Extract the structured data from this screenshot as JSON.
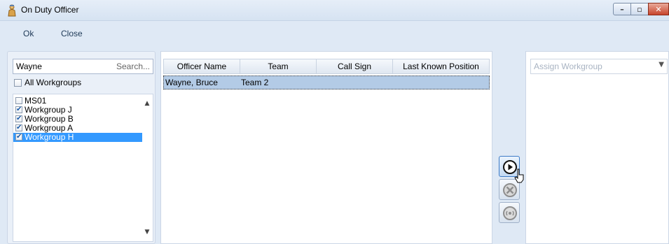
{
  "window": {
    "title": "On Duty Officer",
    "controls": [
      "minimize",
      "maximize",
      "close"
    ]
  },
  "menu": {
    "ok_label": "Ok",
    "close_label": "Close"
  },
  "search": {
    "value": "Wayne",
    "placeholder": "Search..."
  },
  "filters": {
    "all_workgroups_label": "All Workgroups",
    "all_workgroups_checked": false
  },
  "workgroups": [
    {
      "label": "MS01",
      "checked": false,
      "selected": false
    },
    {
      "label": "Workgroup J",
      "checked": true,
      "selected": false
    },
    {
      "label": "Workgroup B",
      "checked": true,
      "selected": false
    },
    {
      "label": "Workgroup A",
      "checked": true,
      "selected": false
    },
    {
      "label": "Workgroup H",
      "checked": true,
      "selected": true
    }
  ],
  "grid": {
    "columns": [
      "Officer Name",
      "Team",
      "Call Sign",
      "Last Known Position"
    ],
    "rows": [
      {
        "officer_name": "Wayne, Bruce",
        "team": "Team 2",
        "call_sign": "",
        "last_known_position": ""
      }
    ]
  },
  "actions": {
    "icons": [
      "play-icon",
      "cancel-icon",
      "radio-signal-icon"
    ]
  },
  "assign": {
    "placeholder": "Assign Workgroup"
  },
  "colors": {
    "window_bg": "#dfe9f5",
    "selection": "#3399ff",
    "grid_selection": "#b3cbe6"
  }
}
